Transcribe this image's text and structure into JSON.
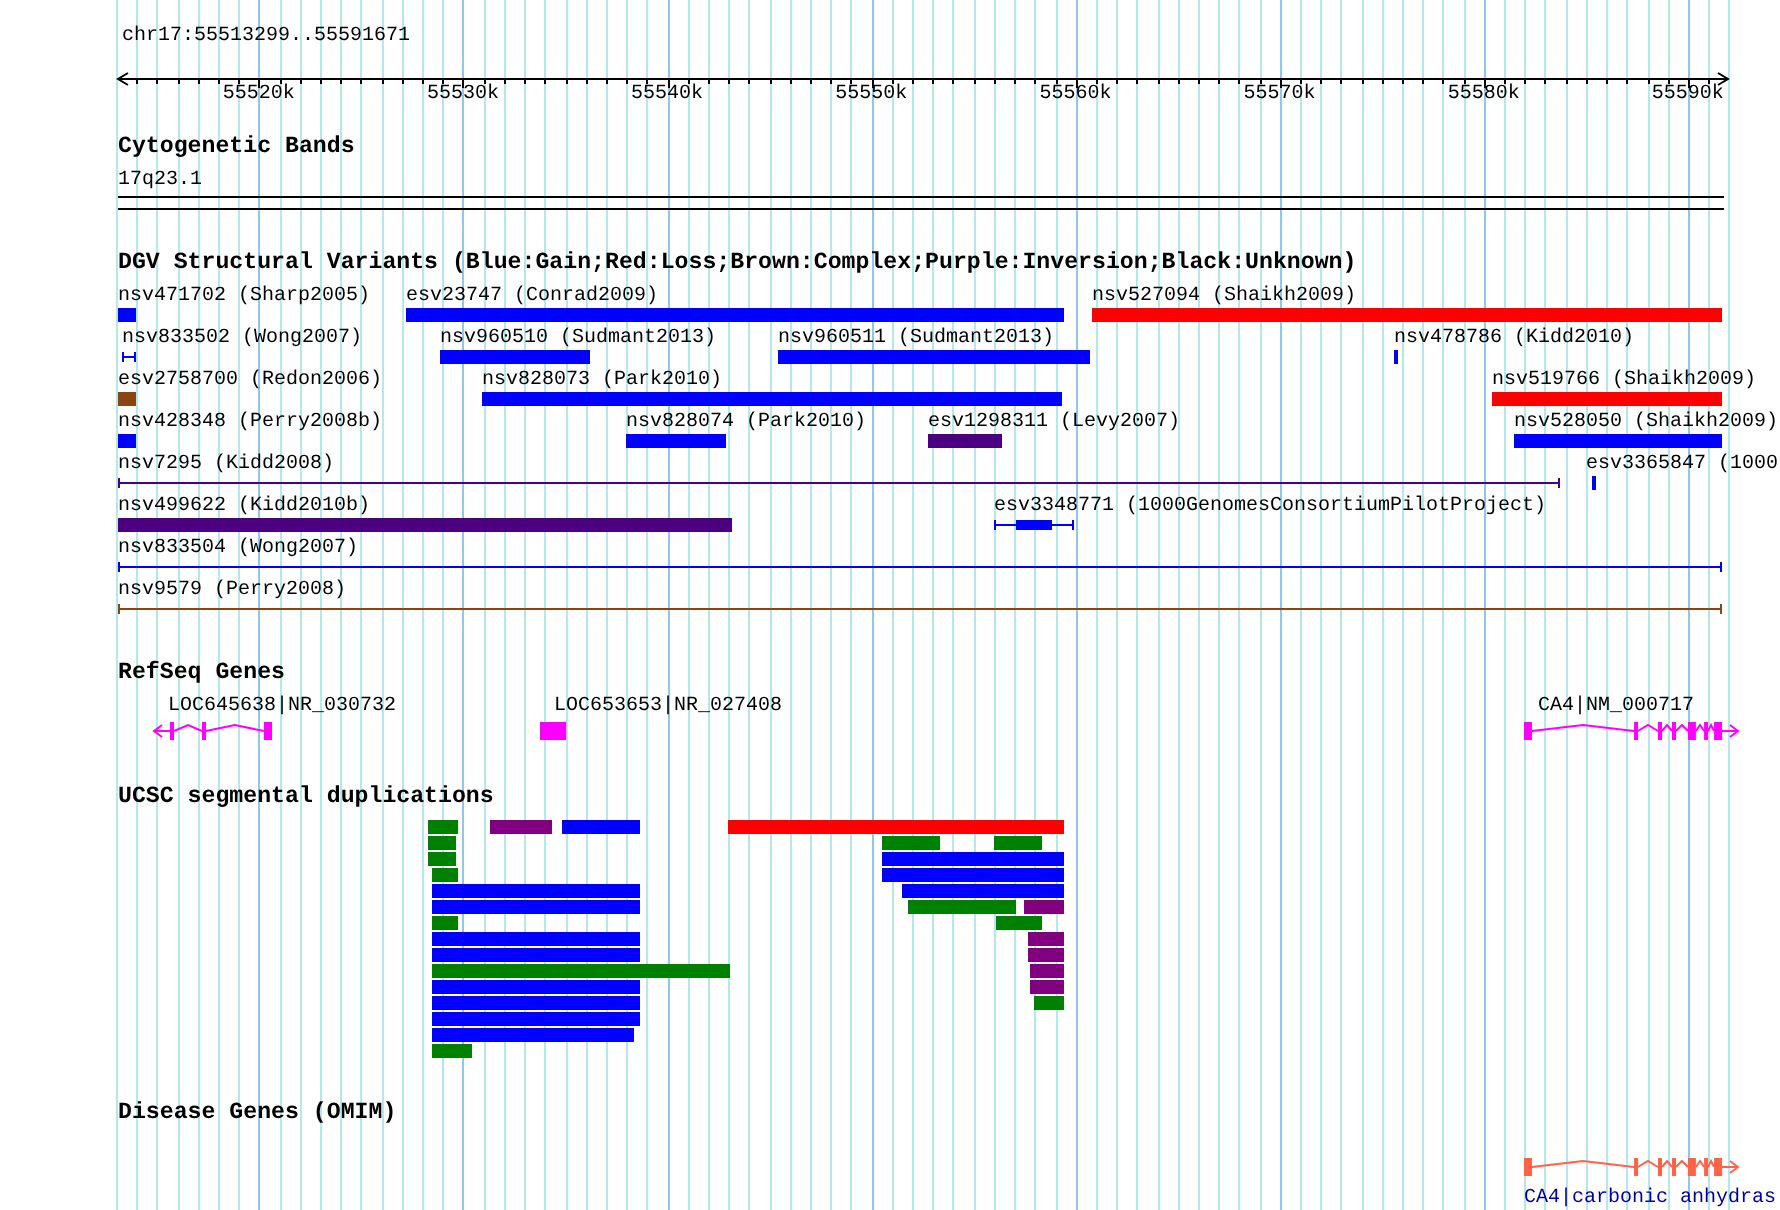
{
  "ruler": {
    "title": "chr17:55513299..55591671",
    "ticks": [
      "55520k",
      "55530k",
      "55540k",
      "55550k",
      "55560k",
      "55570k",
      "55580k",
      "55590k"
    ]
  },
  "tracks": [
    {
      "kind": "cytoband",
      "title": "Cytogenetic Bands",
      "bands": [
        {
          "label": "17q23.1"
        }
      ]
    },
    {
      "kind": "variants",
      "title": "DGV Structural Variants (Blue:Gain;Red:Loss;Brown:Complex;Purple:Inversion;Black:Unknown)",
      "rows": [
        {
          "features": [
            {
              "kind": "bar",
              "label": "nsv471702 (Sharp2005)",
              "color": "#0000ff"
            },
            {
              "kind": "bar",
              "label": "esv23747 (Conrad2009)",
              "color": "#0000ff"
            },
            {
              "kind": "bar",
              "label": "nsv527094 (Shaikh2009)",
              "color": "#ff0000"
            }
          ]
        },
        {
          "features": [
            {
              "kind": "line",
              "label": "nsv833502 (Wong2007)",
              "color": "#0000ff"
            },
            {
              "kind": "bar",
              "label": "nsv960510 (Sudmant2013)",
              "color": "#0000ff"
            },
            {
              "kind": "bar",
              "label": "nsv960511 (Sudmant2013)",
              "color": "#0000ff"
            },
            {
              "kind": "bar",
              "label": "nsv478786 (Kidd2010)",
              "color": "#0000ff"
            }
          ]
        },
        {
          "features": [
            {
              "kind": "bar",
              "label": "esv2758700 (Redon2006)",
              "color": "#8b4513"
            },
            {
              "kind": "bar",
              "label": "nsv828073 (Park2010)",
              "color": "#0000ff"
            },
            {
              "kind": "bar",
              "label": "nsv519766 (Shaikh2009)",
              "color": "#ff0000"
            }
          ]
        },
        {
          "features": [
            {
              "kind": "bar",
              "label": "nsv428348 (Perry2008b)",
              "color": "#0000ff"
            },
            {
              "kind": "bar",
              "label": "nsv828074 (Park2010)",
              "color": "#0000ff"
            },
            {
              "kind": "bar",
              "label": "esv1298311 (Levy2007)",
              "color": "#4b0082"
            },
            {
              "kind": "bar",
              "label": "nsv528050 (Shaikh2009)",
              "color": "#0000ff"
            }
          ]
        },
        {
          "features": [
            {
              "kind": "line",
              "label": "nsv7295 (Kidd2008)",
              "color": "#4b0082"
            },
            {
              "kind": "bar",
              "label": "esv3365847 (1000",
              "color": "#0000ff"
            }
          ]
        },
        {
          "features": [
            {
              "kind": "bar",
              "label": "nsv499622 (Kidd2010b)",
              "color": "#4b0082"
            },
            {
              "kind": "gapped",
              "label": "esv3348771 (1000GenomesConsortiumPilotProject)",
              "color": "#0000ff"
            }
          ]
        },
        {
          "features": [
            {
              "kind": "line",
              "label": "nsv833504 (Wong2007)",
              "color": "#0000ff"
            }
          ]
        },
        {
          "features": [
            {
              "kind": "line",
              "label": "nsv9579 (Perry2008)",
              "color": "#8b4513"
            }
          ]
        }
      ]
    },
    {
      "kind": "genes",
      "title": "RefSeq Genes",
      "genes": [
        {
          "kind": "reverse",
          "label": "LOC645638|NR_030732",
          "color": "#ff00ff"
        },
        {
          "kind": "single",
          "label": "LOC653653|NR_027408",
          "color": "#ff00ff"
        },
        {
          "kind": "forward",
          "label": "CA4|NM_000717",
          "color": "#ff00ff"
        }
      ]
    },
    {
      "kind": "duplications",
      "title": "UCSC segmental duplications",
      "rows": [
        {
          "features": [
            {
              "color": "#008000"
            },
            {
              "color": "#800080"
            },
            {
              "color": "#0000ff"
            },
            {
              "color": "#ff0000"
            }
          ]
        },
        {
          "features": [
            {
              "color": "#008000"
            },
            {
              "color": "#008000"
            },
            {
              "color": "#008000"
            }
          ]
        },
        {
          "features": [
            {
              "color": "#008000"
            },
            {
              "color": "#0000ff"
            }
          ]
        },
        {
          "features": [
            {
              "color": "#008000"
            },
            {
              "color": "#0000ff"
            }
          ]
        },
        {
          "features": [
            {
              "color": "#0000ff"
            },
            {
              "color": "#0000ff"
            }
          ]
        },
        {
          "features": [
            {
              "color": "#0000ff"
            },
            {
              "color": "#008000"
            },
            {
              "color": "#800080"
            }
          ]
        },
        {
          "features": [
            {
              "color": "#008000"
            },
            {
              "color": "#008000"
            }
          ]
        },
        {
          "features": [
            {
              "color": "#0000ff"
            },
            {
              "color": "#800080"
            }
          ]
        },
        {
          "features": [
            {
              "color": "#0000ff"
            },
            {
              "color": "#800080"
            }
          ]
        },
        {
          "features": [
            {
              "color": "#008000"
            },
            {
              "color": "#800080"
            }
          ]
        },
        {
          "features": [
            {
              "color": "#0000ff"
            },
            {
              "color": "#800080"
            }
          ]
        },
        {
          "features": [
            {
              "color": "#0000ff"
            },
            {
              "color": "#008000"
            }
          ]
        },
        {
          "features": [
            {
              "color": "#0000ff"
            }
          ]
        },
        {
          "features": [
            {
              "color": "#0000ff"
            }
          ]
        },
        {
          "features": [
            {
              "color": "#008000"
            }
          ]
        }
      ]
    },
    {
      "kind": "omim",
      "title": "Disease Genes (OMIM)",
      "genes": [
        {
          "kind": "forward",
          "label": "CA4|carbonic anhydras",
          "color": "#ff6347"
        }
      ]
    }
  ]
}
